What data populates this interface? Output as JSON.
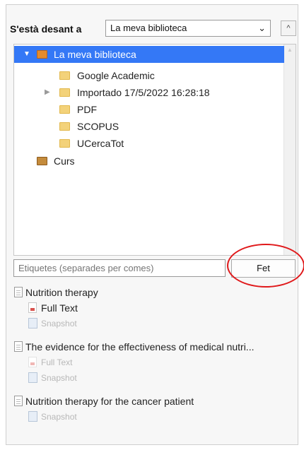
{
  "header": {
    "save_label": "S'està desant a",
    "library_select_value": "La meva biblioteca",
    "expand_glyph": "^"
  },
  "tree": {
    "items": [
      {
        "label": "La meva biblioteca",
        "expanded": true,
        "selected": true,
        "icon": "library-folder-icon"
      },
      {
        "label": "Google Academic",
        "icon": "folder-icon"
      },
      {
        "label": "Importado 17/5/2022 16:28:18",
        "collapsed": true,
        "icon": "folder-icon"
      },
      {
        "label": "PDF",
        "icon": "folder-icon"
      },
      {
        "label": "SCOPUS",
        "icon": "folder-icon"
      },
      {
        "label": "UCercaTot",
        "icon": "folder-icon"
      },
      {
        "label": "Curs",
        "icon": "library-folder-icon"
      }
    ]
  },
  "tags": {
    "placeholder": "Etiquetes (separades per comes)"
  },
  "done_button": {
    "label": "Fet"
  },
  "saved_items": [
    {
      "label": "Nutrition therapy",
      "type": "document",
      "dim": false
    },
    {
      "label": "Full Text",
      "type": "pdf",
      "dim": false
    },
    {
      "label": "Snapshot",
      "type": "snapshot",
      "dim": true
    },
    {
      "label": "The evidence for the effectiveness of medical nutri...",
      "type": "document",
      "dim": false
    },
    {
      "label": "Full Text",
      "type": "pdf",
      "dim": true
    },
    {
      "label": "Snapshot",
      "type": "snapshot",
      "dim": true
    },
    {
      "label": "Nutrition therapy for the cancer patient",
      "type": "document",
      "dim": false
    },
    {
      "label": "Snapshot",
      "type": "snapshot",
      "dim": true
    }
  ],
  "colors": {
    "selection": "#3478f6",
    "annotation_ring": "#e0191b"
  }
}
